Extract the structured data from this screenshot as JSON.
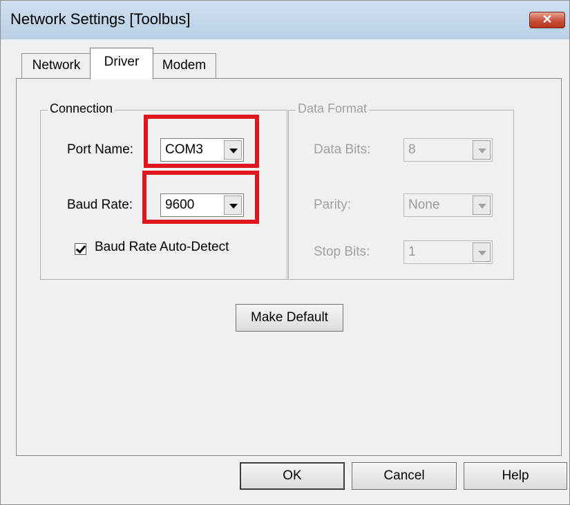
{
  "window": {
    "title": "Network Settings [Toolbus]",
    "close_label": "✕"
  },
  "tabs": [
    {
      "label": "Network"
    },
    {
      "label": "Driver"
    },
    {
      "label": "Modem"
    }
  ],
  "connection": {
    "legend": "Connection",
    "port_name_label": "Port Name:",
    "port_name_value": "COM3",
    "baud_rate_label": "Baud Rate:",
    "baud_rate_value": "9600",
    "auto_detect_label": "Baud Rate Auto-Detect",
    "auto_detect_checked": true
  },
  "data_format": {
    "legend": "Data Format",
    "data_bits_label": "Data Bits:",
    "data_bits_value": "8",
    "parity_label": "Parity:",
    "parity_value": "None",
    "stop_bits_label": "Stop Bits:",
    "stop_bits_value": "1"
  },
  "make_default_label": "Make Default",
  "footer": {
    "ok_label": "OK",
    "cancel_label": "Cancel",
    "help_label": "Help"
  },
  "colors": {
    "highlight": "#e0161e",
    "close_button": "#c8503a"
  }
}
